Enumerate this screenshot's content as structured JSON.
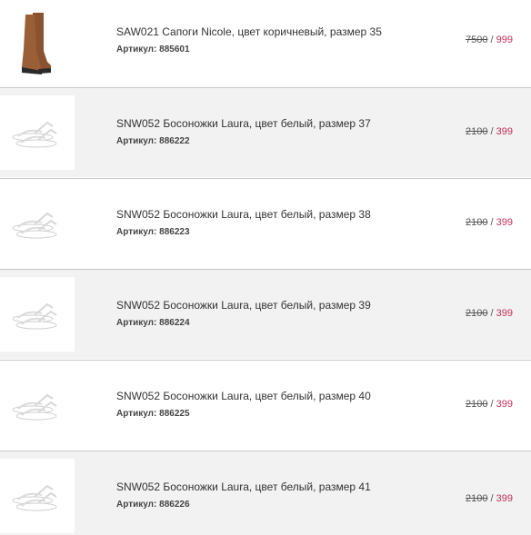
{
  "sku_label": "Артикул:",
  "price_separator": " / ",
  "colors": {
    "new_price": "#c0305a",
    "row_alt_bg": "#f2f2f2",
    "divider": "#c8c8c8"
  },
  "items": [
    {
      "title": "SAW021 Сапоги Nicole, цвет коричневый, размер 35",
      "sku": "885601",
      "old_price": "7500",
      "new_price": "999",
      "image": "brown-boots-icon"
    },
    {
      "title": "SNW052 Босоножки Laura, цвет белый, размер 37",
      "sku": "886222",
      "old_price": "2100",
      "new_price": "399",
      "image": "white-sandals-icon"
    },
    {
      "title": "SNW052 Босоножки Laura, цвет белый, размер 38",
      "sku": "886223",
      "old_price": "2100",
      "new_price": "399",
      "image": "white-sandals-icon"
    },
    {
      "title": "SNW052 Босоножки Laura, цвет белый, размер 39",
      "sku": "886224",
      "old_price": "2100",
      "new_price": "399",
      "image": "white-sandals-icon"
    },
    {
      "title": "SNW052 Босоножки Laura, цвет белый, размер 40",
      "sku": "886225",
      "old_price": "2100",
      "new_price": "399",
      "image": "white-sandals-icon"
    },
    {
      "title": "SNW052 Босоножки Laura, цвет белый, размер 41",
      "sku": "886226",
      "old_price": "2100",
      "new_price": "399",
      "image": "white-sandals-icon"
    }
  ]
}
